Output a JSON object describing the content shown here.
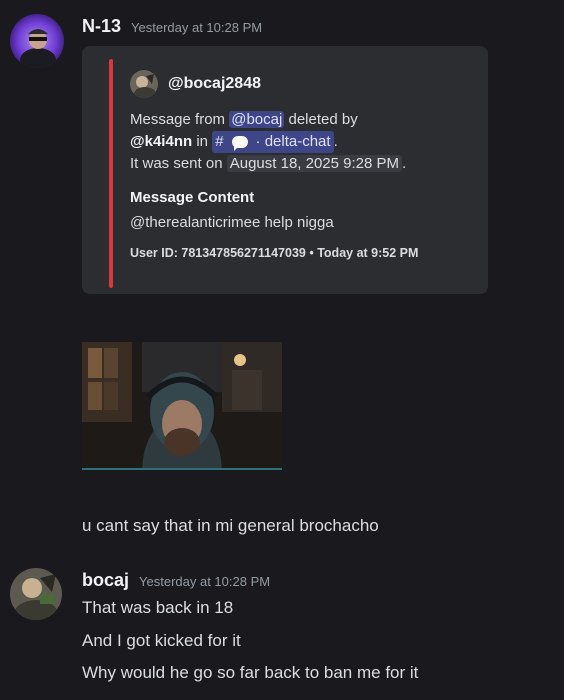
{
  "messages": [
    {
      "username": "N-13",
      "timestamp": "Yesterday at 10:28 PM",
      "embed": {
        "author": "@bocaj2848",
        "desc_prefix": "Message from",
        "mention_from": "@bocaj",
        "desc_deleted_by": "deleted by",
        "mention_by": "@k4i4nn",
        "desc_in": "in",
        "channel_hash": "#",
        "channel_name": "· delta-chat",
        "desc_period": ".",
        "sent_prefix": "It was sent on",
        "sent_date": "August 18, 2025 9:28 PM",
        "sent_period": ".",
        "field_name": "Message Content",
        "field_value": "@therealanticrimee help nigga",
        "footer_user_id": "User ID: 781347856271147039",
        "footer_sep": "•",
        "footer_time": "Today at 9:52 PM",
        "accent_color": "#da373c"
      },
      "text": "u cant say that in mi general brochacho"
    },
    {
      "username": "bocaj",
      "timestamp": "Yesterday at 10:28 PM",
      "lines": [
        "That was back in 18",
        "And I got kicked for it",
        "Why would he go so far back to ban me for it"
      ]
    }
  ],
  "colors": {
    "background": "#1a1a1e",
    "embed_background": "#2b2d31",
    "mention_background": "#4e57a8"
  }
}
